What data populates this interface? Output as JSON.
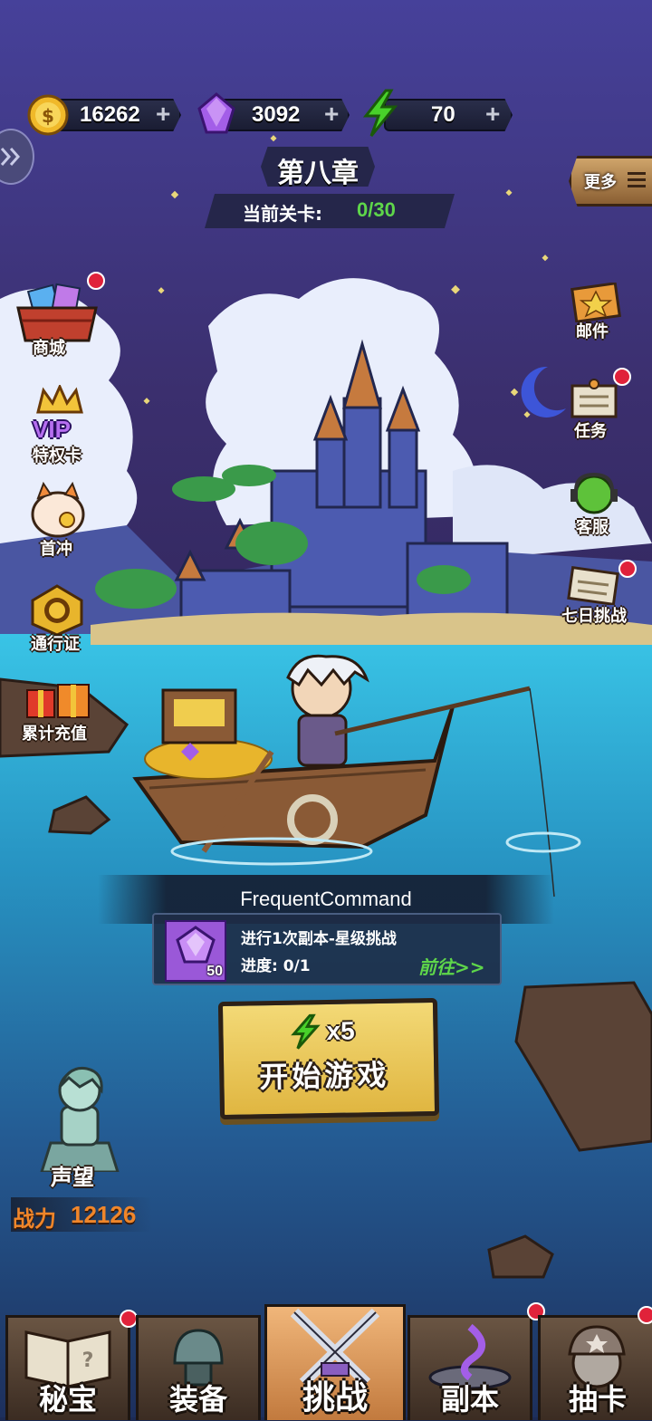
{
  "resources": {
    "coins": "16262",
    "gems": "3092",
    "energy": "70",
    "plus": "+"
  },
  "chapter": {
    "title": "第八章",
    "stage_label": "当前关卡:",
    "stage_value": "0/30"
  },
  "more_label": "更多",
  "left_menu": {
    "shop": "商城",
    "vip": "特权卡",
    "vip_badge": "VIP",
    "first_charge": "首冲",
    "pass": "通行证",
    "cumulative": "累计充值"
  },
  "right_menu": {
    "mail": "邮件",
    "tasks": "任务",
    "support": "客服",
    "seven_day": "七日挑战"
  },
  "command": {
    "header": "FrequentCommand",
    "task": "进行1次副本-星级挑战",
    "progress": "进度: 0/1",
    "reward_count": "50",
    "go_label": "前往>>"
  },
  "start": {
    "cost": "x5",
    "label": "开始游戏"
  },
  "reputation": {
    "label": "声望",
    "power_label": "战力",
    "power_value": "12126"
  },
  "nav": {
    "treasure": "秘宝",
    "equipment": "装备",
    "challenge": "挑战",
    "dungeon": "副本",
    "gacha": "抽卡"
  },
  "colors": {
    "sky": "#3d3579",
    "sea": "#2a9fc9",
    "gold": "#e8b52c",
    "gem": "#a35ee8",
    "energy": "#48d12a",
    "green_text": "#5ed64a",
    "power": "#f0862a",
    "badge": "#e0223a"
  }
}
